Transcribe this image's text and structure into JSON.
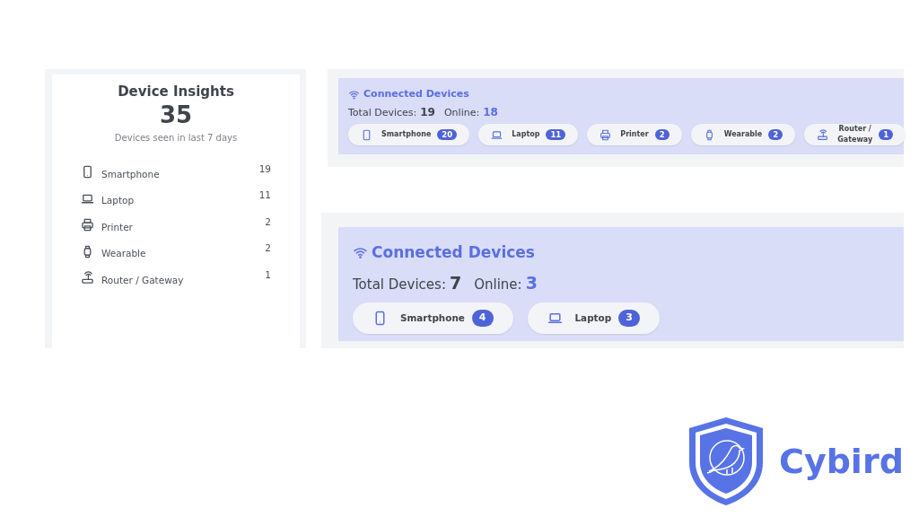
{
  "insights": {
    "title": "Device Insights",
    "total": "35",
    "subtitle": "Devices seen in last 7 days",
    "devices": [
      {
        "kind": "smartphone",
        "label": "Smartphone",
        "count": "19"
      },
      {
        "kind": "laptop",
        "label": "Laptop",
        "count": "11"
      },
      {
        "kind": "printer",
        "label": "Printer",
        "count": "2"
      },
      {
        "kind": "wearable",
        "label": "Wearable",
        "count": "2"
      },
      {
        "kind": "router",
        "label": "Router / Gateway",
        "count": "1"
      }
    ]
  },
  "panels": [
    {
      "title": "Connected Devices",
      "total_label": "Total Devices:",
      "total": "19",
      "online_label": "Online:",
      "online": "18",
      "devices": [
        {
          "kind": "smartphone",
          "label": "Smartphone",
          "count": "20"
        },
        {
          "kind": "laptop",
          "label": "Laptop",
          "count": "11"
        },
        {
          "kind": "printer",
          "label": "Printer",
          "count": "2"
        },
        {
          "kind": "wearable",
          "label": "Wearable",
          "count": "2"
        },
        {
          "kind": "router",
          "label": "Router / Gateway",
          "count": "1"
        }
      ]
    },
    {
      "title": "Connected Devices",
      "total_label": "Total Devices:",
      "total": "7",
      "online_label": "Online:",
      "online": "3",
      "devices": [
        {
          "kind": "smartphone",
          "label": "Smartphone",
          "count": "4"
        },
        {
          "kind": "laptop",
          "label": "Laptop",
          "count": "3"
        }
      ]
    }
  ],
  "logo": {
    "name": "Cybird"
  }
}
